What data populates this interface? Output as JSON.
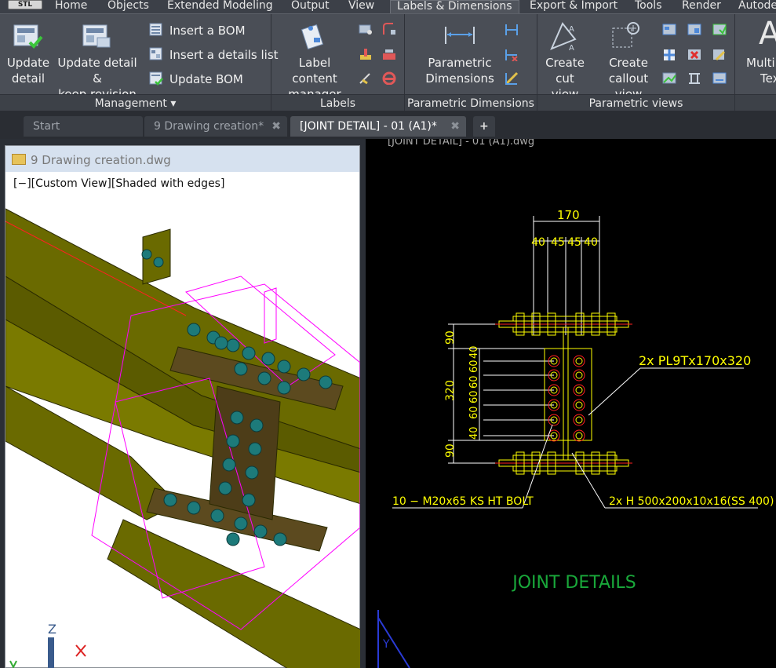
{
  "ribbon_tabs": {
    "badge": "STL",
    "home": "Home",
    "objects": "Objects",
    "extended_modeling": "Extended Modeling",
    "output": "Output",
    "view": "View",
    "labels_dimensions": "Labels & Dimensions",
    "export_import": "Export & Import",
    "tools": "Tools",
    "render": "Render",
    "autodesk": "Autode"
  },
  "ribbon": {
    "management": {
      "title": "Management",
      "update_detail": [
        "Update",
        "detail"
      ],
      "update_keep": [
        "Update detail &",
        "keep revision"
      ],
      "insert_bom": "Insert a BOM",
      "insert_details_list": "Insert a details list",
      "update_bom": "Update BOM"
    },
    "labels": {
      "title": "Labels",
      "label_content_manager": [
        "Label content",
        "manager"
      ]
    },
    "parametric_dimensions": {
      "title": "Parametric Dimensions",
      "button": [
        "Parametric",
        "Dimensions"
      ]
    },
    "parametric_views": {
      "title": "Parametric views",
      "create_cut_view": [
        "Create",
        "cut view"
      ],
      "create_callout_view": [
        "Create",
        "callout view"
      ]
    },
    "multi_text": [
      "Multi",
      "Tex"
    ]
  },
  "doc_tabs": {
    "start": "Start",
    "drawing_creation": "9 Drawing creation*",
    "joint_detail": "[JOINT DETAIL] - 01 (A1)*",
    "close_glyph": "✖",
    "add_glyph": "+"
  },
  "left_viewport": {
    "title": "9 Drawing creation.dwg",
    "view_label": "[−][Custom View][Shaded with edges]",
    "ucs_z": "Z",
    "ucs_y": "Y",
    "ucs_x": "X"
  },
  "right_viewport": {
    "title": "[JOINT DETAIL] - 01 (A1).dwg",
    "dim_total_width": "170",
    "dim_top": [
      "40",
      "45",
      "45",
      "40"
    ],
    "dim_flange_top": "90",
    "dim_flange_bottom": "90",
    "dim_web_total": "320",
    "dim_left_stack": [
      "40",
      "60",
      "60",
      "60",
      "60",
      "40"
    ],
    "plate_label": "2x  PL9Tx170x320",
    "bolt_label": "10 − M20x65  KS  HT  BOLT",
    "beam_label": "2x  H  500x200x10x16(SS 400)",
    "heading": "JOINT DETAILS",
    "ucs_y": "Y"
  },
  "colors": {
    "cad_yellow": "#ffff00",
    "cad_white": "#ffffff",
    "cad_red": "#ff2020",
    "cad_green": "#19a83a",
    "cad_magenta": "#ff00ff",
    "beam_olive": "#6b6b00",
    "bolt_teal": "#1d7a7a"
  }
}
